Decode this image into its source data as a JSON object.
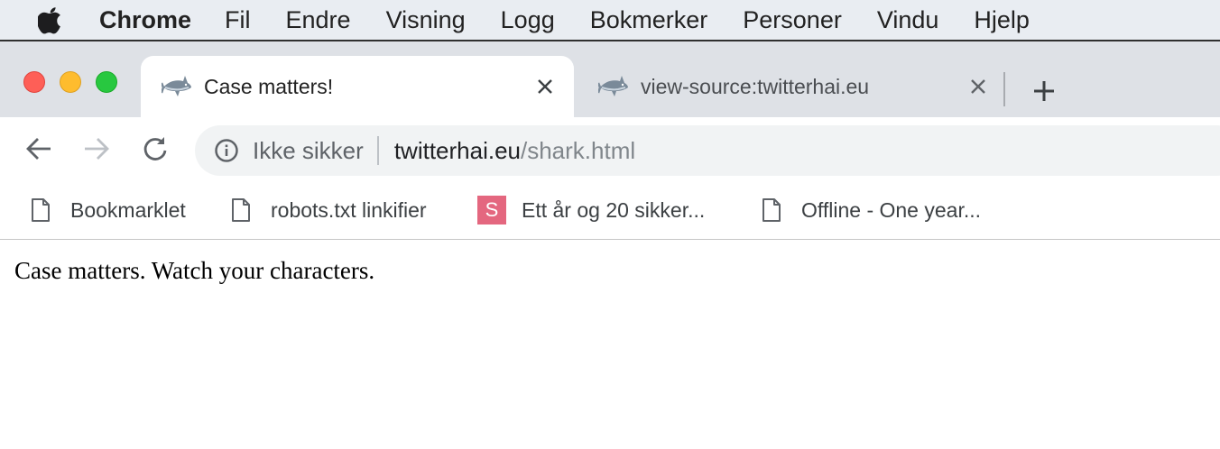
{
  "menubar": {
    "app_name": "Chrome",
    "items": [
      "Fil",
      "Endre",
      "Visning",
      "Logg",
      "Bokmerker",
      "Personer",
      "Vindu",
      "Hjelp"
    ]
  },
  "tabs": [
    {
      "title": "Case matters!",
      "icon": "shark-icon",
      "active": true
    },
    {
      "title": "view-source:twitterhai.eu",
      "icon": "shark-icon",
      "active": false
    }
  ],
  "omnibox": {
    "security_label": "Ikke sikker",
    "url_host": "twitterhai.eu",
    "url_path": "/shark.html"
  },
  "bookmarks": [
    {
      "label": "Bookmarklet",
      "icon": "page-icon"
    },
    {
      "label": "robots.txt linkifier",
      "icon": "page-icon"
    },
    {
      "label": "Ett år og 20 sikker...",
      "icon": "s-badge-icon",
      "badge": "S"
    },
    {
      "label": "Offline - One year...",
      "icon": "page-icon"
    }
  ],
  "page": {
    "text": "Case matters. Watch your characters."
  },
  "colors": {
    "close_red": "#fe5f57",
    "minimize_yellow": "#febc2e",
    "zoom_green": "#28c840",
    "tabstrip_bg": "#dee1e6",
    "bookmark_badge": "#e4677f"
  }
}
